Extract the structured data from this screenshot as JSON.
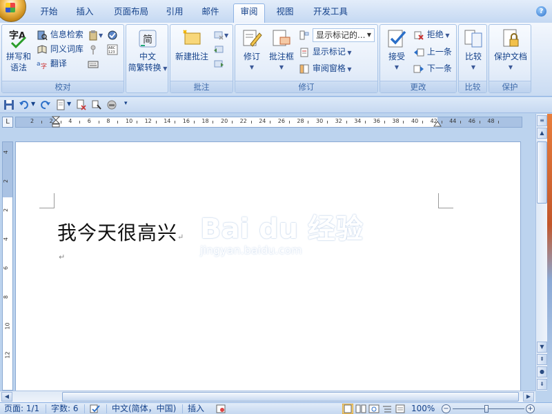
{
  "tabs": [
    {
      "label": "开始"
    },
    {
      "label": "插入"
    },
    {
      "label": "页面布局"
    },
    {
      "label": "引用"
    },
    {
      "label": "邮件"
    },
    {
      "label": "审阅",
      "active": true
    },
    {
      "label": "视图"
    },
    {
      "label": "开发工具"
    }
  ],
  "ribbon": {
    "proofing": {
      "label": "校对",
      "spelling": "拼写和\n语法",
      "spelling_line1": "拼写和",
      "spelling_line2": "语法",
      "research": "信息检索",
      "thesaurus": "同义词库",
      "translate": "翻译"
    },
    "chinese": {
      "line1": "中文",
      "line2": "简繁转换"
    },
    "comments": {
      "label": "批注",
      "new_comment": "新建批注"
    },
    "tracking": {
      "label": "修订",
      "track_changes": "修订",
      "balloons": "批注框",
      "display_for_review": "显示标记的...",
      "show_markup": "显示标记",
      "reviewing_pane": "审阅窗格"
    },
    "changes": {
      "label": "更改",
      "accept": "接受",
      "reject": "拒绝",
      "previous": "上一条",
      "next": "下一条"
    },
    "compare": {
      "label": "比较",
      "compare": "比较"
    },
    "protect": {
      "label": "保护",
      "protect_document": "保护文档"
    }
  },
  "ruler_ticks": [
    "2",
    "2",
    "4",
    "6",
    "8",
    "10",
    "12",
    "14",
    "16",
    "18",
    "20",
    "22",
    "24",
    "26",
    "28",
    "30",
    "32",
    "34",
    "36",
    "38",
    "40",
    "42",
    "44",
    "46",
    "48"
  ],
  "vruler_ticks": [
    "4",
    "2",
    "2",
    "4",
    "6",
    "8",
    "10",
    "12"
  ],
  "document": {
    "text": "我今天很高兴",
    "para_mark": "↵"
  },
  "watermark": {
    "main": "Bai du 经验",
    "sub": "jingyan.baidu.com"
  },
  "statusbar": {
    "page": "页面: 1/1",
    "words": "字数: 6",
    "language": "中文(简体，中国)",
    "insert_mode": "插入",
    "zoom": "100%"
  },
  "colors": {
    "ribbon_text": "#15428b",
    "frame_blue": "#bcd3ee",
    "accent_orange": "#e87e3d"
  }
}
